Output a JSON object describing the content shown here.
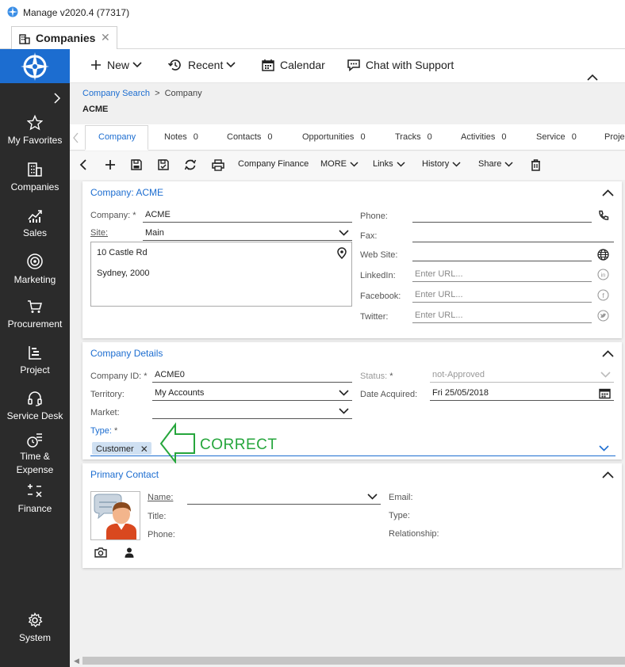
{
  "window": {
    "title": "Manage v2020.4 (77317)"
  },
  "doc_tab": {
    "label": "Companies",
    "close": "✕"
  },
  "sidebar": {
    "items": [
      {
        "label": "My Favorites",
        "icon": "star-icon"
      },
      {
        "label": "Companies",
        "icon": "building-icon"
      },
      {
        "label": "Sales",
        "icon": "chart-icon"
      },
      {
        "label": "Marketing",
        "icon": "target-icon"
      },
      {
        "label": "Procurement",
        "icon": "cart-icon"
      },
      {
        "label": "Project",
        "icon": "project-icon"
      },
      {
        "label": "Service Desk",
        "icon": "headset-icon"
      },
      {
        "label": "Time &",
        "label2": "Expense",
        "icon": "time-expense-icon"
      },
      {
        "label": "Finance",
        "icon": "calculator-icon"
      },
      {
        "label": "System",
        "icon": "gear-icon"
      }
    ]
  },
  "topbar": {
    "new": "New",
    "recent": "Recent",
    "calendar": "Calendar",
    "chat": "Chat with Support"
  },
  "breadcrumb": {
    "parent": "Company Search",
    "separator": ">",
    "current": "Company"
  },
  "record": {
    "title": "ACME"
  },
  "record_tabs": [
    {
      "label": "Company",
      "count": ""
    },
    {
      "label": "Notes",
      "count": "0"
    },
    {
      "label": "Contacts",
      "count": "0"
    },
    {
      "label": "Opportunities",
      "count": "0"
    },
    {
      "label": "Tracks",
      "count": "0"
    },
    {
      "label": "Activities",
      "count": "0"
    },
    {
      "label": "Service",
      "count": "0"
    },
    {
      "label": "Proje",
      "count": ""
    }
  ],
  "actions": {
    "company_finance": "Company Finance",
    "more": "MORE",
    "links": "Links",
    "history": "History",
    "share": "Share"
  },
  "company_panel": {
    "title": "Company: ACME",
    "company_label": "Company:",
    "company_value": "ACME",
    "site_label": "Site:",
    "site_value": "Main",
    "address_line1": "10 Castle Rd",
    "address_line2": "Sydney, 2000",
    "phone_label": "Phone:",
    "fax_label": "Fax:",
    "website_label": "Web Site:",
    "linkedin_label": "LinkedIn:",
    "linkedin_placeholder": "Enter URL...",
    "facebook_label": "Facebook:",
    "facebook_placeholder": "Enter URL...",
    "twitter_label": "Twitter:",
    "twitter_placeholder": "Enter URL..."
  },
  "details_panel": {
    "title": "Company Details",
    "company_id_label": "Company ID:",
    "company_id_value": "ACME0",
    "territory_label": "Territory:",
    "territory_value": "My Accounts",
    "market_label": "Market:",
    "market_value": "",
    "type_label": "Type:",
    "type_chip": "Customer",
    "status_label": "Status:",
    "status_value": "not-Approved",
    "date_acquired_label": "Date Acquired:",
    "date_acquired_value": "Fri 25/05/2018"
  },
  "annotation": {
    "text": "CORRECT",
    "color": "#26a63c"
  },
  "primary_contact": {
    "title": "Primary Contact",
    "name_label": "Name:",
    "title_label": "Title:",
    "phone_label": "Phone:",
    "email_label": "Email:",
    "type_label": "Type:",
    "relationship_label": "Relationship:"
  },
  "colors": {
    "accent": "#1c6dd0",
    "sidebar": "#2b2b2b",
    "chip": "#cfe0f2"
  }
}
